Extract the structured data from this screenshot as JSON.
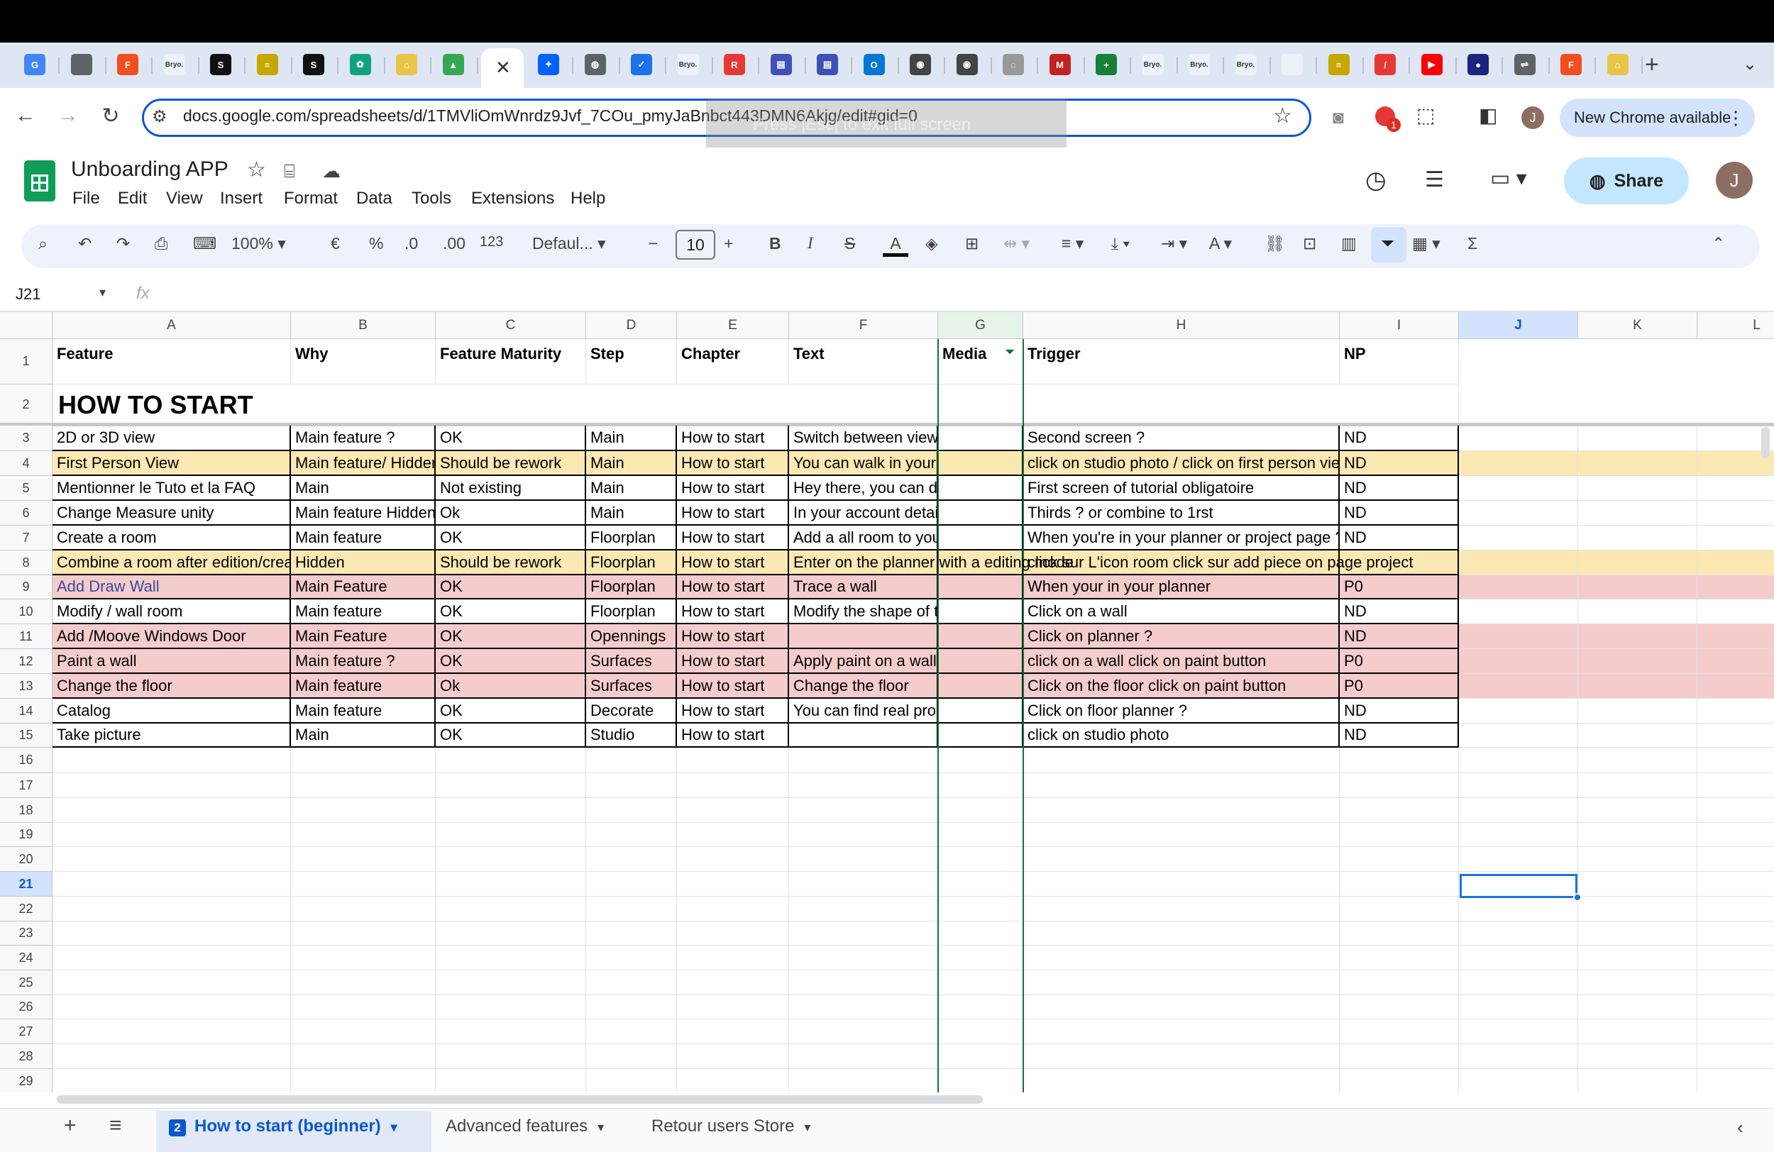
{
  "browser": {
    "tab_favicons": [
      {
        "label": "G",
        "color": "#4285f4"
      },
      {
        "label": "",
        "color": "#5f6368"
      },
      {
        "label": "F",
        "color": "#f24e1e"
      },
      {
        "label": "Bryo.",
        "color": "#eef1f7"
      },
      {
        "label": "S",
        "color": "#111111"
      },
      {
        "label": "≡",
        "color": "#c6a700"
      },
      {
        "label": "S",
        "color": "#111111"
      },
      {
        "label": "✿",
        "color": "#10a37f"
      },
      {
        "label": "⌂",
        "color": "#e8c547"
      },
      {
        "label": "▲",
        "color": "#34a853"
      }
    ],
    "tab_favicons_right": [
      {
        "label": "✦",
        "color": "#0061ff"
      },
      {
        "label": "◍",
        "color": "#5f6368"
      },
      {
        "label": "✓",
        "color": "#1a73e8"
      },
      {
        "label": "Bryo.",
        "color": "#eef1f7"
      },
      {
        "label": "R",
        "color": "#e53935"
      },
      {
        "label": "▤",
        "color": "#3f51b5"
      },
      {
        "label": "▤",
        "color": "#3f51b5"
      },
      {
        "label": "O",
        "color": "#0078d4"
      },
      {
        "label": "◉",
        "color": "#444444"
      },
      {
        "label": "◉",
        "color": "#444444"
      },
      {
        "label": "◌",
        "color": "#999999"
      },
      {
        "label": "M",
        "color": "#c5221f"
      },
      {
        "label": "+",
        "color": "#188038"
      },
      {
        "label": "Bryo.",
        "color": "#eef1f7"
      },
      {
        "label": "Bryo.",
        "color": "#eef1f7"
      },
      {
        "label": "Bryo.",
        "color": "#eef1f7"
      },
      {
        "label": "",
        "color": "#eef1f7"
      },
      {
        "label": "≡",
        "color": "#c6a700"
      },
      {
        "label": "/",
        "color": "#e53935"
      },
      {
        "label": "▶",
        "color": "#ff0000"
      },
      {
        "label": "●",
        "color": "#1a237e"
      },
      {
        "label": "⇌",
        "color": "#5f6368"
      },
      {
        "label": "F",
        "color": "#f24e1e"
      },
      {
        "label": "⌂",
        "color": "#e8c547"
      }
    ],
    "new_tab": "+",
    "url": "docs.google.com/spreadsheets/d/1TMVliOmWnrdz9Jvf_7COu_pmyJaBnbct443DMN6Akjg/edit#gid=0",
    "overlay_text": "Press |Esc| to exit full screen",
    "new_chrome": "New Chrome available",
    "ext_badge": "1",
    "profile_letter": "J"
  },
  "app": {
    "title": "Unboarding APP",
    "menus": [
      "File",
      "Edit",
      "View",
      "Insert",
      "Format",
      "Data",
      "Tools",
      "Extensions",
      "Help"
    ],
    "share": "Share",
    "avatar": "J"
  },
  "toolbar": {
    "zoom": "100%",
    "currency": "€",
    "percent": "%",
    "dec_less": ".0",
    "dec_more": ".00",
    "format_123": "123",
    "font": "Defaul...",
    "font_size": "10",
    "bold": "B",
    "italic": "I",
    "strike": "S",
    "text_color": "A",
    "sigma": "Σ"
  },
  "formula": {
    "cell_ref": "J21",
    "fx": "fx"
  },
  "sheet": {
    "columns": [
      "A",
      "B",
      "C",
      "D",
      "E",
      "F",
      "G",
      "H",
      "I",
      "J",
      "K",
      "L"
    ],
    "header": [
      "Feature",
      "Why",
      "Feature Maturity",
      "Step",
      "Chapter",
      "Text",
      "Media",
      "Trigger",
      "NP"
    ],
    "section_title": "HOW TO START",
    "rows": [
      {
        "n": "3",
        "fill": "",
        "cells": [
          "2D or 3D view",
          "Main feature ?",
          "OK",
          "Main",
          "How to start",
          "Switch between views",
          "",
          "Second screen ?",
          "ND"
        ]
      },
      {
        "n": "4",
        "fill": "#fce8b2",
        "cells": [
          "First Person View",
          "Main feature/ Hidden",
          "Should be rework",
          "Main",
          "How to start",
          "You can walk in your room and take",
          "",
          "click on studio photo / click on first person view",
          "ND"
        ]
      },
      {
        "n": "5",
        "fill": "",
        "cells": [
          "Mentionner le Tuto et la FAQ",
          "Main",
          "Not existing",
          "Main",
          "How to start",
          "Hey there, you can deactivate this",
          "",
          "First screen of tutorial obligatoire",
          "ND"
        ]
      },
      {
        "n": "6",
        "fill": "",
        "cells": [
          "Change Measure unity",
          "Main feature Hidden",
          "Ok",
          "Main",
          "How to start",
          "In your account details you can adjust",
          "",
          "Thirds ? or combine to 1rst",
          "ND"
        ]
      },
      {
        "n": "7",
        "fill": "",
        "cells": [
          "Create a room",
          "Main feature",
          "OK",
          "Floorplan",
          "How to start",
          "Add a all room to your plan",
          "",
          "When you're in your planner or project page ?",
          "ND"
        ]
      },
      {
        "n": "8",
        "fill": "#fce8b2",
        "cells": [
          "Combine a room after edition/creation",
          "Hidden",
          "Should be rework",
          "Floorplan",
          "How to start",
          "Enter on the planner with a editing mode",
          "",
          "click sur L'icon room click sur add piece on page project",
          ""
        ]
      },
      {
        "n": "9",
        "fill": "#f4cccc",
        "cells": [
          "Add Draw Wall",
          "Main Feature",
          "OK",
          "Floorplan",
          "How to start",
          "Trace a wall",
          "",
          "When your in your planner",
          "P0"
        ]
      },
      {
        "n": "10",
        "fill": "",
        "cells": [
          "Modify / wall room",
          "Main feature",
          "OK",
          "Floorplan",
          "How to start",
          "Modify the shape of the room",
          "",
          "Click on a wall",
          "ND"
        ]
      },
      {
        "n": "11",
        "fill": "#f4cccc",
        "cells": [
          "Add /Moove Windows Door",
          "Main Feature",
          "OK",
          "Opennings",
          "How to start",
          "",
          "",
          "Click on planner ?",
          "ND"
        ]
      },
      {
        "n": "12",
        "fill": "#f4cccc",
        "cells": [
          "Paint a wall",
          "Main feature ?",
          "OK",
          "Surfaces",
          "How to start",
          "Apply paint on a wall",
          "",
          "click on a wall click on paint button",
          "P0"
        ]
      },
      {
        "n": "13",
        "fill": "#f4cccc",
        "cells": [
          "Change the floor",
          "Main feature",
          "Ok",
          "Surfaces",
          "How to start",
          "Change the floor",
          "",
          "Click on the floor click on paint button",
          "P0"
        ]
      },
      {
        "n": "14",
        "fill": "",
        "cells": [
          "Catalog",
          "Main feature",
          "OK",
          "Decorate",
          "How to start",
          "You can find real product for your",
          "",
          "Click on floor planner ?",
          "ND"
        ]
      },
      {
        "n": "15",
        "fill": "",
        "cells": [
          "Take picture",
          "Main",
          "OK",
          "Studio",
          "How to start",
          "",
          "",
          "click on studio photo",
          "ND"
        ]
      }
    ],
    "empty_rows": [
      "16",
      "17",
      "18",
      "19",
      "20",
      "21",
      "22",
      "23",
      "24",
      "25",
      "26",
      "27",
      "28",
      "29"
    ],
    "link_color": "#3c4a9c"
  },
  "sheet_tabs": {
    "add": "+",
    "list": "≡",
    "tabs": [
      {
        "label": "How to start (beginner)",
        "badge": "2",
        "active": true
      },
      {
        "label": "Advanced features",
        "active": false
      },
      {
        "label": "Retour users Store",
        "active": false
      }
    ]
  }
}
